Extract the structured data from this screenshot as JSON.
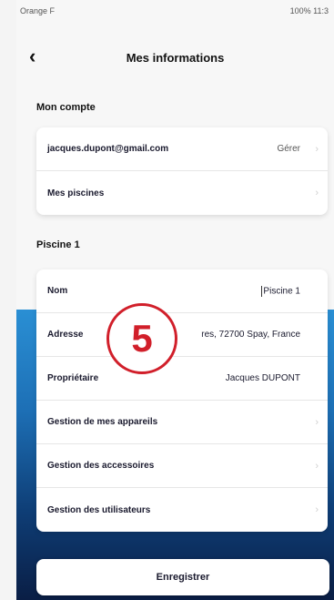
{
  "status_bar": {
    "carrier": "Orange F",
    "right": "100% 11:3"
  },
  "header": {
    "title": "Mes informations"
  },
  "account": {
    "section_title": "Mon compte",
    "email": "jacques.dupont@gmail.com",
    "manage_label": "Gérer",
    "pools_label": "Mes piscines"
  },
  "pool": {
    "section_title": "Piscine 1",
    "rows": [
      {
        "label": "Nom",
        "value": "Piscine 1"
      },
      {
        "label": "Adresse",
        "value": "res, 72700 Spay, France"
      },
      {
        "label": "Propriétaire",
        "value": "Jacques DUPONT"
      },
      {
        "label": "Gestion de mes appareils"
      },
      {
        "label": "Gestion des accessoires"
      },
      {
        "label": "Gestion des utilisateurs"
      }
    ]
  },
  "badge": {
    "number": "5"
  },
  "save_label": "Enregistrer",
  "colors": {
    "accent": "#d11f2a",
    "water": "#1d6fb5"
  }
}
